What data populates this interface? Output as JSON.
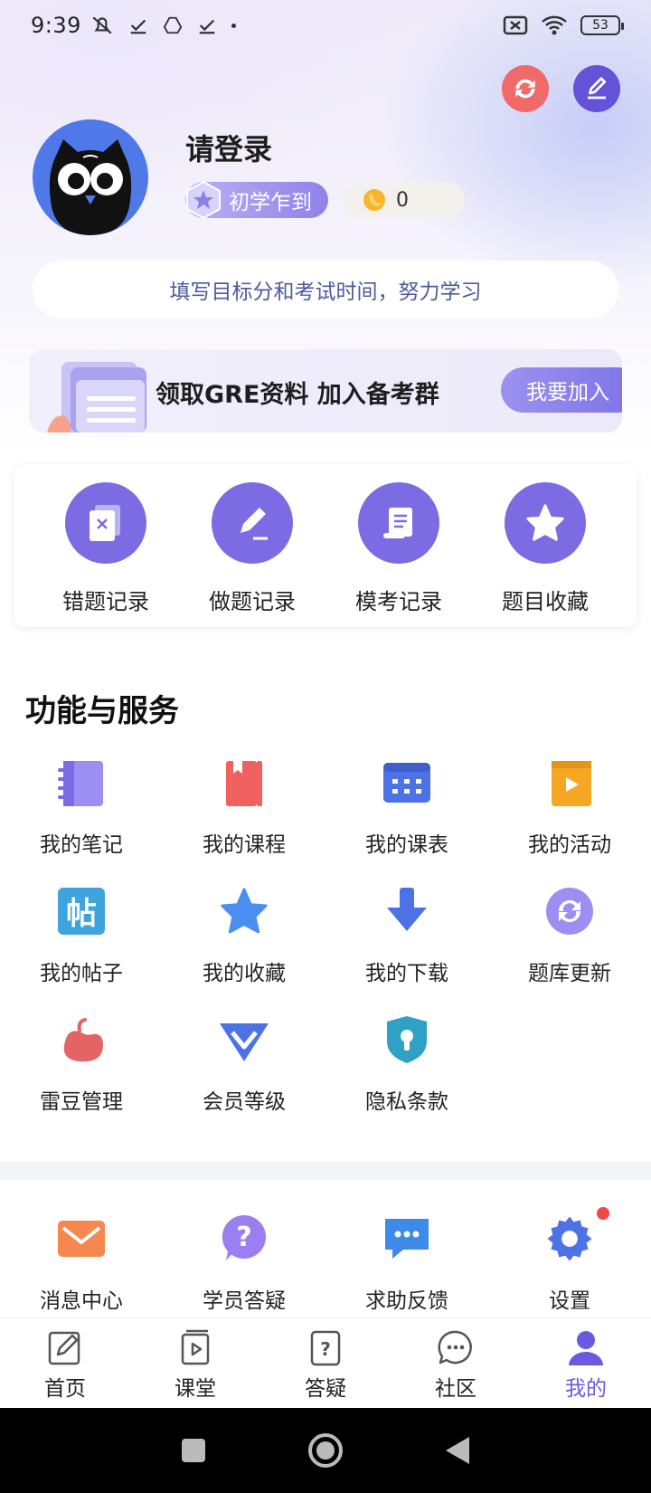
{
  "status_bar": {
    "time": "9:39",
    "battery": "53"
  },
  "profile": {
    "username": "请登录",
    "level": "初学乍到",
    "coins": "0",
    "goal_hint": "填写目标分和考试时间，努力学习"
  },
  "banner": {
    "text": "领取GRE资料  加入备考群",
    "join_label": "我要加入"
  },
  "records": [
    {
      "label": "错题记录",
      "icon": "wrong-questions-icon"
    },
    {
      "label": "做题记录",
      "icon": "pencil-record-icon"
    },
    {
      "label": "模考记录",
      "icon": "scroll-icon"
    },
    {
      "label": "题目收藏",
      "icon": "star-icon"
    }
  ],
  "services": {
    "title": "功能与服务",
    "items": [
      {
        "label": "我的笔记",
        "icon": "notebook-icon"
      },
      {
        "label": "我的课程",
        "icon": "book-icon"
      },
      {
        "label": "我的课表",
        "icon": "calendar-icon"
      },
      {
        "label": "我的活动",
        "icon": "play-card-icon"
      },
      {
        "label": "我的帖子",
        "icon": "post-icon"
      },
      {
        "label": "我的收藏",
        "icon": "star-icon"
      },
      {
        "label": "我的下载",
        "icon": "download-icon"
      },
      {
        "label": "题库更新",
        "icon": "refresh-icon"
      },
      {
        "label": "雷豆管理",
        "icon": "bean-icon"
      },
      {
        "label": "会员等级",
        "icon": "vip-icon"
      },
      {
        "label": "隐私条款",
        "icon": "privacy-shield-icon"
      }
    ]
  },
  "more": [
    {
      "label": "消息中心",
      "icon": "mail-icon"
    },
    {
      "label": "学员答疑",
      "icon": "question-icon"
    },
    {
      "label": "求助反馈",
      "icon": "chat-icon"
    },
    {
      "label": "设置",
      "icon": "gear-icon"
    }
  ],
  "tabs": [
    {
      "label": "首页",
      "icon": "home-edit-icon"
    },
    {
      "label": "课堂",
      "icon": "classroom-icon"
    },
    {
      "label": "答疑",
      "icon": "qa-icon"
    },
    {
      "label": "社区",
      "icon": "community-icon"
    },
    {
      "label": "我的",
      "icon": "profile-icon"
    }
  ],
  "colors": {
    "accent": "#6a5ae0",
    "record_circle": "#7b6ce4",
    "refresh_button": "#f06a6a",
    "edit_button": "#6452d8"
  }
}
